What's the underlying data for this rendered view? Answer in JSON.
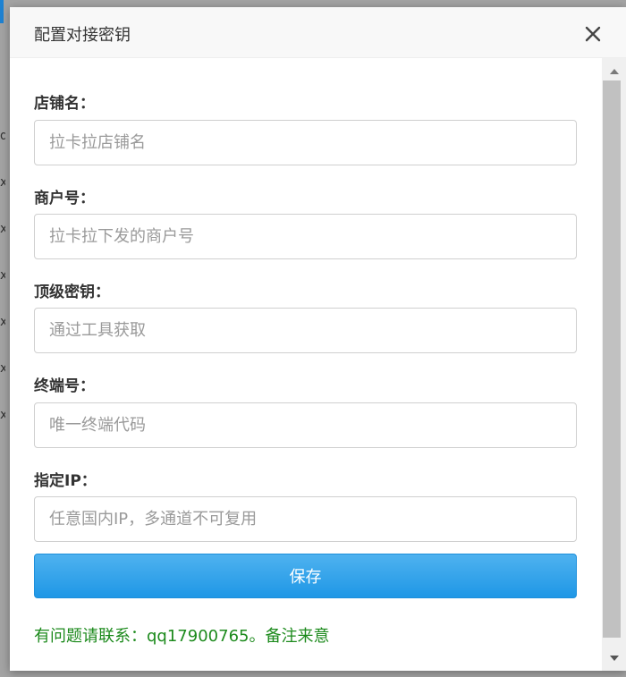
{
  "dialog": {
    "title": "配置对接密钥",
    "close_icon": "close-icon"
  },
  "form": {
    "fields": [
      {
        "label": "店铺名：",
        "placeholder": "拉卡拉店铺名",
        "value": ""
      },
      {
        "label": "商户号：",
        "placeholder": "拉卡拉下发的商户号",
        "value": ""
      },
      {
        "label": "顶级密钥：",
        "placeholder": "通过工具获取",
        "value": ""
      },
      {
        "label": "终端号：",
        "placeholder": "唯一终端代码",
        "value": ""
      },
      {
        "label": "指定IP：",
        "placeholder": "任意国内IP，多通道不可复用",
        "value": ""
      }
    ],
    "save_label": "保存",
    "contact_note": "有问题请联系：qq17900765。备注来意"
  },
  "colors": {
    "primary_button": "#2196e6",
    "note_text": "#1c8a1c",
    "header_bg": "#f8f8f8"
  }
}
